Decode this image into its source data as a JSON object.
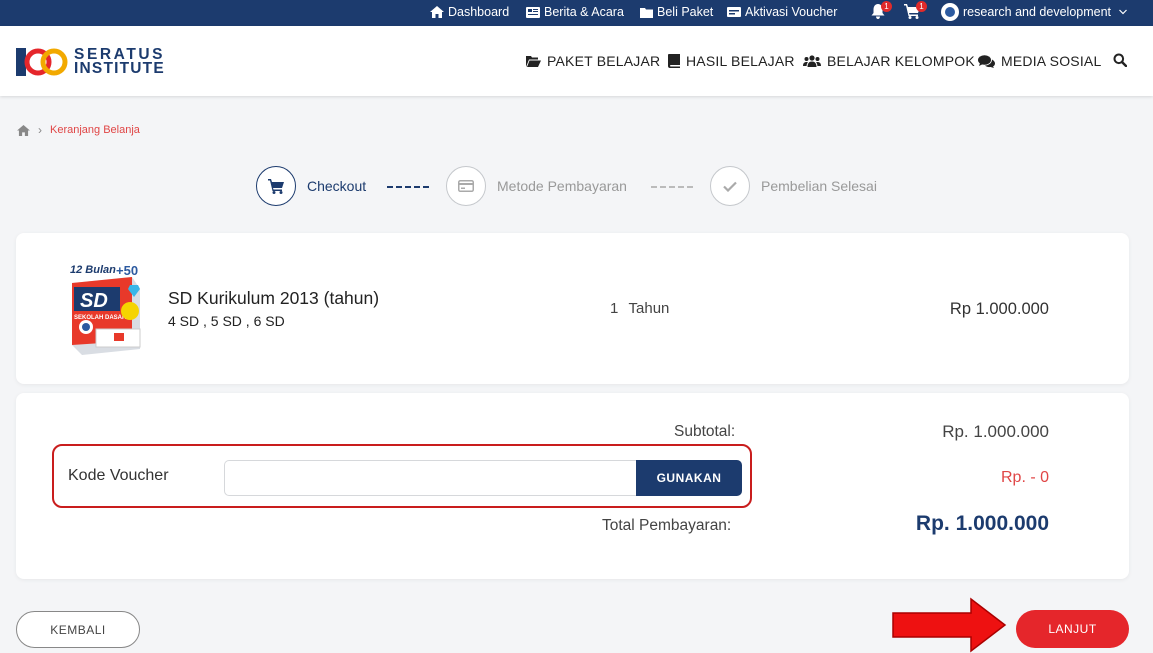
{
  "topbar": {
    "dashboard": "Dashboard",
    "news": "Berita & Acara",
    "buy": "Beli Paket",
    "voucher": "Aktivasi Voucher",
    "notif_count": "1",
    "cart_count": "1",
    "user": "research and development"
  },
  "brand": {
    "line1": "SERATUS",
    "line2": "INSTITUTE"
  },
  "nav": {
    "paket": "PAKET BELAJAR",
    "hasil": "HASIL BELAJAR",
    "kelompok": "BELAJAR KELOMPOK",
    "sosial": "MEDIA SOSIAL"
  },
  "breadcrumb": {
    "current": "Keranjang Belanja"
  },
  "steps": [
    "Checkout",
    "Metode Pembayaran",
    "Pembelian Selesai"
  ],
  "product": {
    "name": "SD Kurikulum 2013 (tahun)",
    "grades": "4 SD , 5 SD , 6 SD",
    "qty": "1",
    "duration": "Tahun",
    "price": "Rp 1.000.000",
    "box_top": "12 Bulan",
    "box_badge": "+50",
    "box_title": "SD",
    "box_sub": "SEKOLAH DASAR"
  },
  "voucher": {
    "label": "Kode Voucher",
    "placeholder": "",
    "button": "GUNAKAN"
  },
  "summary": {
    "subtotal_label": "Subtotal:",
    "subtotal_value": "Rp. 1.000.000",
    "discount_value": "Rp. - 0",
    "total_label": "Total Pembayaran:",
    "total_value": "Rp. 1.000.000"
  },
  "actions": {
    "back": "KEMBALI",
    "next": "LANJUT"
  },
  "colors": {
    "navy": "#1c3b6e",
    "red": "#e5262b",
    "discount": "#e04646"
  }
}
